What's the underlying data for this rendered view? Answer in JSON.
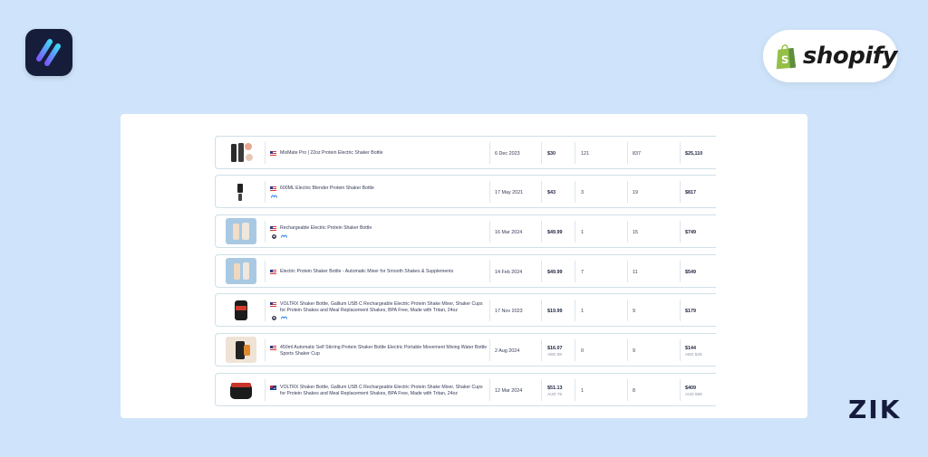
{
  "brand": {
    "app_logo": "slash-logo-icon",
    "shopify_label": "shopify",
    "zik_label": "ZIK"
  },
  "products": [
    {
      "title": "MixMate Pro | 22oz Protein Electric Shaker Bottle",
      "flag": "us-flag-icon",
      "icons": [],
      "date": "6 Dec 2023",
      "price": "$30",
      "price_sub": "",
      "col3": "121",
      "col4": "837",
      "revenue": "$25,110",
      "revenue_sub": ""
    },
    {
      "title": "600ML Electric Blender Protein Shaker Bottle",
      "flag": "us-flag-icon",
      "icons": [
        "meta-icon"
      ],
      "date": "17 May 2021",
      "price": "$43",
      "price_sub": "",
      "col3": "3",
      "col4": "19",
      "revenue": "$817",
      "revenue_sub": ""
    },
    {
      "title": "Rechargeable Electric Protein Shaker Bottle",
      "flag": "us-flag-icon",
      "icons": [
        "pinterest-icon",
        "meta-icon"
      ],
      "date": "16 Mar 2024",
      "price": "$49.99",
      "price_sub": "",
      "col3": "1",
      "col4": "15",
      "revenue": "$749",
      "revenue_sub": ""
    },
    {
      "title": "Electric Protein Shaker Bottle - Automatic Mixer for Smooth Shakes & Supplements",
      "flag": "us-flag-icon",
      "icons": [],
      "date": "14 Feb 2024",
      "price": "$49.99",
      "price_sub": "",
      "col3": "7",
      "col4": "11",
      "revenue": "$549",
      "revenue_sub": ""
    },
    {
      "title": "VOLTRX Shaker Bottle, Gallium USB C Rechargeable Electric Protein Shake Mixer, Shaker Cups for Protein Shakes and Meal Replacement Shakes, BPA Free, Made with Tritan, 24oz",
      "flag": "us-flag-icon",
      "icons": [
        "pinterest-icon",
        "meta-icon"
      ],
      "date": "17 Nov 2023",
      "price": "$19.99",
      "price_sub": "",
      "col3": "1",
      "col4": "9",
      "revenue": "$179",
      "revenue_sub": ""
    },
    {
      "title": "450ml Automatic Self Stirring Protein Shaker Bottle Electric Portable Movement Mixing Water Bottle Sports Shaker Cup",
      "flag": "us-flag-icon",
      "icons": [],
      "date": "2 Aug 2024",
      "price": "$16.07",
      "price_sub": "AED 59",
      "col3": "0",
      "col4": "9",
      "revenue": "$144",
      "revenue_sub": "AED 529"
    },
    {
      "title": "VOLTRX Shaker Bottle, Gallium USB C Rechargeable Electric Protein Shake Mixer, Shaker Cups for Protein Shakes and Meal Replacement Shakes, BPA Free, Made with Tritan, 24oz",
      "flag": "au-flag-icon",
      "icons": [],
      "date": "12 Mar 2024",
      "price": "$51.13",
      "price_sub": "AUD 75",
      "col3": "1",
      "col4": "8",
      "revenue": "$409",
      "revenue_sub": "AUD 599"
    }
  ],
  "colors": {
    "background": "#cfe4fb",
    "panel": "#ffffff",
    "row_border": "#cfe0e8",
    "text": "#343a56",
    "shopify_green": "#95bf47",
    "logo_bg": "#161d3a"
  }
}
